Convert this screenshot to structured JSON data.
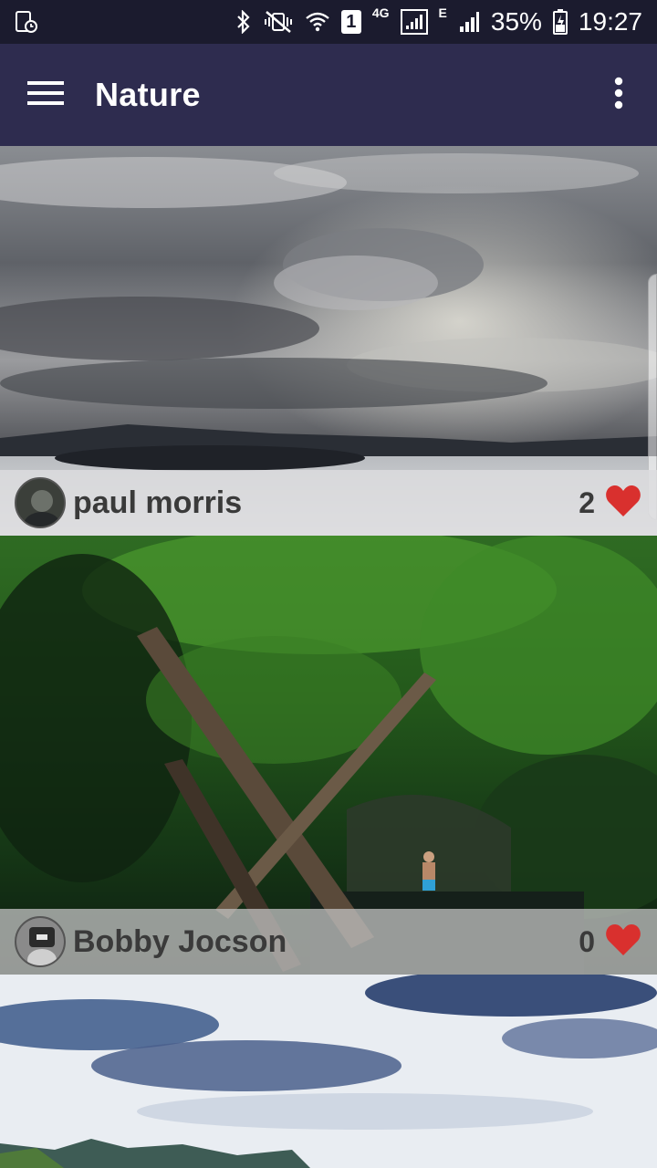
{
  "status_bar": {
    "battery_percent": "35%",
    "time": "19:27",
    "sim_slot": "1",
    "network_4g": "4G",
    "network_e": "E"
  },
  "app_bar": {
    "title": "Nature",
    "menu_icon": "hamburger-menu-icon",
    "overflow_icon": "more-vert-icon"
  },
  "posts": [
    {
      "author": "paul morris",
      "likes": "2",
      "image": "stormy clouds over sea"
    },
    {
      "author": "Bobby Jocson",
      "likes": "0",
      "image": "forest ravine with fallen logs"
    },
    {
      "author": "",
      "likes": "",
      "image": "blue sky with mountains"
    }
  ],
  "colors": {
    "status_bar": "#1b1b2e",
    "app_bar": "#2e2c4f",
    "heart": "#d9302e"
  }
}
